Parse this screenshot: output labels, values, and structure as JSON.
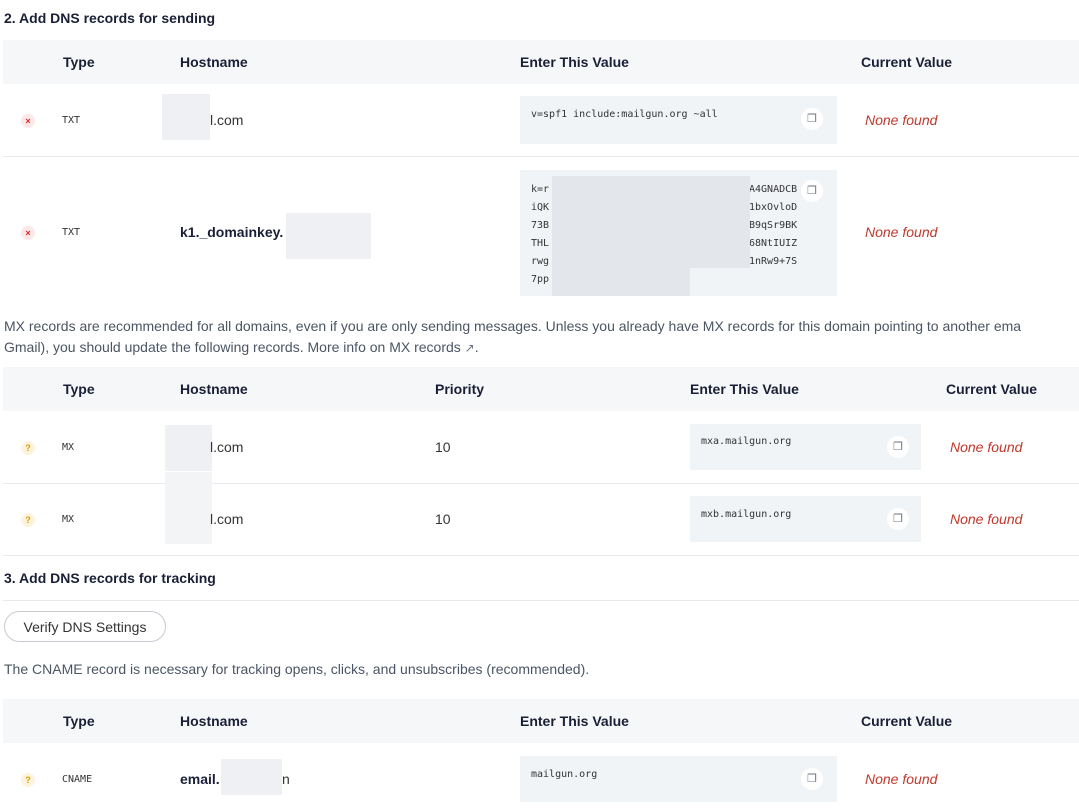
{
  "section_sending": {
    "title": "2. Add DNS records for sending"
  },
  "sending_table": {
    "headers": {
      "type": "Type",
      "hostname": "Hostname",
      "value": "Enter This Value",
      "current": "Current Value"
    },
    "rows": [
      {
        "status": "×",
        "type": "TXT",
        "host_prefix": "",
        "host_suffix": "l.com",
        "value": "v=spf1 include:mailgun.org ~all",
        "current": "None found"
      },
      {
        "status": "×",
        "type": "TXT",
        "host_prefix": "k1._domainkey.",
        "host_suffix": "",
        "value_lines": [
          "k=r",
          "iQK",
          "73B",
          "THL",
          "rwg",
          "7pp"
        ],
        "value_lines_right": [
          "A4GNADCB",
          "1bxOvloD",
          "B9qSr9BK",
          "68NtIUIZ",
          "1nRw9+7S",
          ""
        ],
        "current": "None found"
      }
    ]
  },
  "mx_note": {
    "line1": "MX records are recommended for all domains, even if you are only sending messages. Unless you already have MX records for this domain pointing to another ema",
    "line2": "Gmail), you should update the following records. More info on MX records",
    "link_icon": "external-link-icon"
  },
  "mx_table": {
    "headers": {
      "type": "Type",
      "hostname": "Hostname",
      "priority": "Priority",
      "value": "Enter This Value",
      "current": "Current Value"
    },
    "rows": [
      {
        "status": "?",
        "type": "MX",
        "host_suffix": "l.com",
        "priority": "10",
        "value": "mxa.mailgun.org",
        "current": "None found"
      },
      {
        "status": "?",
        "type": "MX",
        "host_suffix": "l.com",
        "priority": "10",
        "value": "mxb.mailgun.org",
        "current": "None found"
      }
    ]
  },
  "section_tracking": {
    "title": "3. Add DNS records for tracking"
  },
  "verify_button": {
    "label": "Verify DNS Settings"
  },
  "cname_note": {
    "text": "The CNAME record is necessary for tracking opens, clicks, and unsubscribes (recommended)."
  },
  "tracking_table": {
    "headers": {
      "type": "Type",
      "hostname": "Hostname",
      "value": "Enter This Value",
      "current": "Current Value"
    },
    "rows": [
      {
        "status": "?",
        "type": "CNAME",
        "host_prefix": "email.",
        "host_suffix": "n",
        "value": "mailgun.org",
        "current": "None found"
      }
    ]
  },
  "icons": {
    "copy": "copy-icon",
    "error": "error-status-icon",
    "warning": "warning-status-icon"
  },
  "colors": {
    "error": "#dc2626",
    "warning": "#d69e00",
    "none_found": "#c0392b",
    "header_bg": "#f6f7f9",
    "value_bg": "#f1f4f7"
  }
}
